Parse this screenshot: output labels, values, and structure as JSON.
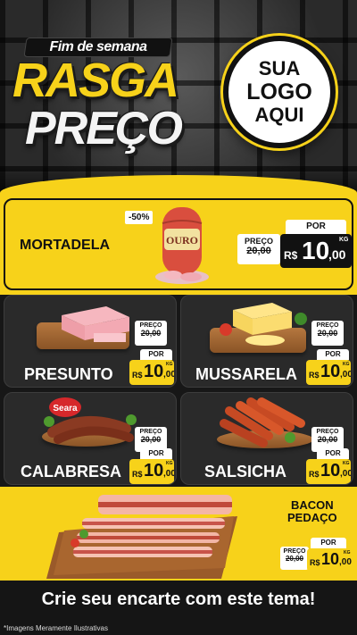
{
  "header": {
    "weekend_label": "Fim de semana",
    "title_line1": "RASGA",
    "title_line2": "PREÇO",
    "logo_line1": "SUA",
    "logo_line2": "LOGO",
    "logo_line3": "AQUI"
  },
  "featured": {
    "name": "MORTADELA",
    "discount": "-50%",
    "brand": "OURO",
    "old_label": "PREÇO",
    "old_price": "20,00",
    "por_label": "POR",
    "currency": "R$",
    "price_int": "10",
    "price_dec": ",00",
    "unit": "KG"
  },
  "products": [
    {
      "name": "PRESUNTO",
      "old_label": "PREÇO",
      "old_price": "20,00",
      "por_label": "POR",
      "currency": "R$",
      "price_int": "10",
      "price_dec": ",00",
      "unit": "KG"
    },
    {
      "name": "MUSSARELA",
      "old_label": "PREÇO",
      "old_price": "20,00",
      "por_label": "POR",
      "currency": "R$",
      "price_int": "10",
      "price_dec": ",00",
      "unit": "KG"
    },
    {
      "name": "CALABRESA",
      "brand": "Seara",
      "old_label": "PREÇO",
      "old_price": "20,00",
      "por_label": "POR",
      "currency": "R$",
      "price_int": "10",
      "price_dec": ",00",
      "unit": "KG"
    },
    {
      "name": "SALSICHA",
      "old_label": "PREÇO",
      "old_price": "20,00",
      "por_label": "POR",
      "currency": "R$",
      "price_int": "10",
      "price_dec": ",00",
      "unit": "KG"
    }
  ],
  "bacon": {
    "name_line1": "BACON",
    "name_line2": "PEDAÇO",
    "old_label": "PREÇO",
    "old_price": "20,00",
    "por_label": "POR",
    "currency": "R$",
    "price_int": "10",
    "price_dec": ",00",
    "unit": "KG"
  },
  "footer": {
    "cta": "Crie seu encarte com este tema!",
    "disclaimer": "*Imagens Meramente Ilustrativas"
  },
  "colors": {
    "accent": "#f7d21a",
    "dark": "#1a1a1a",
    "white": "#ffffff"
  }
}
